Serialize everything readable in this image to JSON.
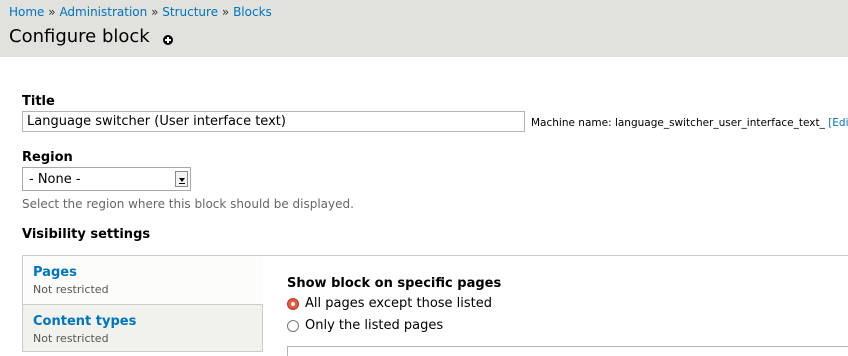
{
  "breadcrumb": {
    "items": [
      "Home",
      "Administration",
      "Structure",
      "Blocks"
    ],
    "separator": "»"
  },
  "page": {
    "title": "Configure block",
    "shortcut_icon": "add-shortcut-icon"
  },
  "form": {
    "title_label": "Title",
    "title_value": "Language switcher (User interface text)",
    "machine_name_prefix": "Machine name: language_switcher_user_interface_text_",
    "machine_name_edit": "[Edit]",
    "region_label": "Region",
    "region_value": "- None -",
    "region_description": "Select the region where this block should be displayed.",
    "visibility_label": "Visibility settings"
  },
  "vertical_tabs": [
    {
      "title": "Pages",
      "summary": "Not restricted",
      "selected": true
    },
    {
      "title": "Content types",
      "summary": "Not restricted",
      "selected": false
    }
  ],
  "pane": {
    "heading": "Show block on specific pages",
    "options": [
      {
        "label": "All pages except those listed",
        "checked": true
      },
      {
        "label": "Only the listed pages",
        "checked": false
      }
    ]
  },
  "colors": {
    "header_bg": "#e1e1dd",
    "link": "#0074bd",
    "radio_selected": "#e9573f"
  }
}
